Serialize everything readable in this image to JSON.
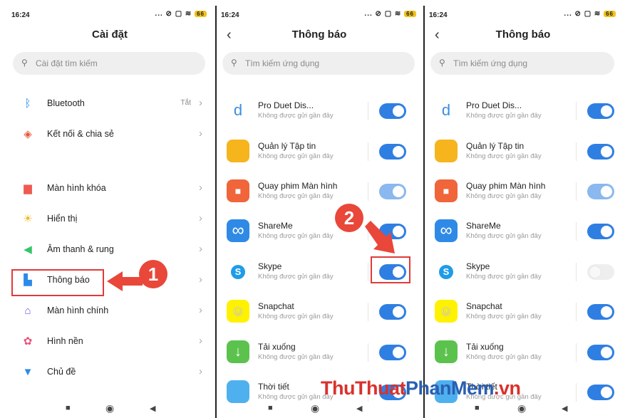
{
  "status": {
    "time": "16:24",
    "icons": "... ⊘ ▢ ≋",
    "battery": "66"
  },
  "panel1": {
    "title": "Cài đặt",
    "search_placeholder": "Cài đặt tìm kiếm",
    "items": [
      {
        "label": "Bluetooth",
        "value": "Tắt",
        "icon": "bluetooth-icon",
        "color": "#2d8be8"
      },
      {
        "label": "Kết nối & chia sẻ",
        "value": "",
        "icon": "share-icon",
        "color": "#e8553a"
      },
      {
        "label": "Màn hình khóa",
        "value": "",
        "icon": "lock-icon",
        "color": "#ef5a50"
      },
      {
        "label": "Hiển thị",
        "value": "",
        "icon": "sun-icon",
        "color": "#f3b51f"
      },
      {
        "label": "Âm thanh & rung",
        "value": "",
        "icon": "speaker-icon",
        "color": "#36c46a"
      },
      {
        "label": "Thông báo",
        "value": "",
        "icon": "notification-icon",
        "color": "#2d8be8"
      },
      {
        "label": "Màn hình chính",
        "value": "",
        "icon": "home-icon",
        "color": "#6b5ae8"
      },
      {
        "label": "Hình nền",
        "value": "",
        "icon": "wallpaper-icon",
        "color": "#e8517a"
      },
      {
        "label": "Chủ đề",
        "value": "",
        "icon": "theme-icon",
        "color": "#2d8be8"
      }
    ]
  },
  "notifications": {
    "title": "Thông báo",
    "search_placeholder": "Tìm kiếm ứng dụng",
    "sub": "Không được gửi gần đây",
    "apps": [
      {
        "name": "Pro Duet Dis...",
        "glyph": "d",
        "color": "#ffffff"
      },
      {
        "name": "Quản lý Tập tin",
        "glyph": "",
        "color": "#f6b41d"
      },
      {
        "name": "Quay phim Màn hình",
        "glyph": "■",
        "color": "#f0653a"
      },
      {
        "name": "ShareMe",
        "glyph": "∞",
        "color": "#2f8ae6"
      },
      {
        "name": "Skype",
        "glyph": "S",
        "color": "#ffffff"
      },
      {
        "name": "Snapchat",
        "glyph": "☺",
        "color": "#fff200"
      },
      {
        "name": "Tải xuống",
        "glyph": "↓",
        "color": "#5cc24e"
      },
      {
        "name": "Thời tiết",
        "glyph": "",
        "color": "#4fb0ef"
      }
    ]
  },
  "annotations": {
    "step1": "1",
    "step2": "2"
  },
  "watermark": {
    "part1": "ThuThuat",
    "part2": "PhanMem",
    "part3": ".vn"
  }
}
